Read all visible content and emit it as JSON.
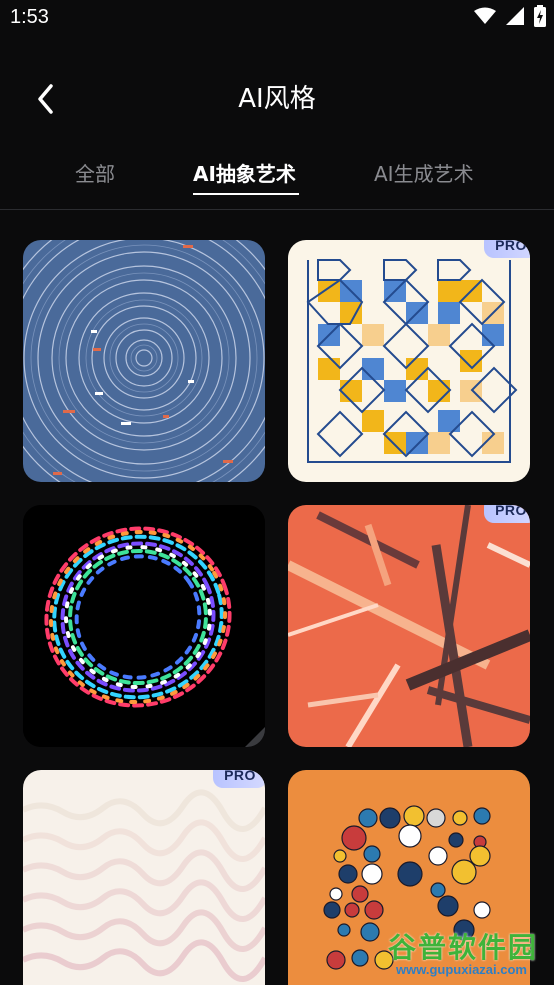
{
  "status_bar": {
    "time": "1:53",
    "icons": [
      "wifi-icon",
      "signal-icon",
      "battery-charging-icon"
    ]
  },
  "header": {
    "title": "AI风格",
    "back_icon": "chevron-left-icon"
  },
  "tabs": [
    {
      "label": "全部",
      "active": false
    },
    {
      "label": "AI抽象艺术",
      "active": true
    },
    {
      "label": "AI生成艺术",
      "active": false
    }
  ],
  "cards": [
    {
      "name": "blue-circles",
      "pro": false
    },
    {
      "name": "geometric-pattern",
      "pro": true,
      "badge": "PRO"
    },
    {
      "name": "color-ring",
      "pro": false
    },
    {
      "name": "orange-lines",
      "pro": true,
      "badge": "PRO"
    },
    {
      "name": "white-waves",
      "pro": true,
      "badge": "PRO"
    },
    {
      "name": "circle-dots",
      "pro": false
    }
  ],
  "watermark": {
    "main": "谷普软件园",
    "url": "www.gupuxiazai.com"
  },
  "colors": {
    "background": "#0b0b0c",
    "tab_inactive": "#8a8b90",
    "pro_badge": "#c8ceff"
  }
}
